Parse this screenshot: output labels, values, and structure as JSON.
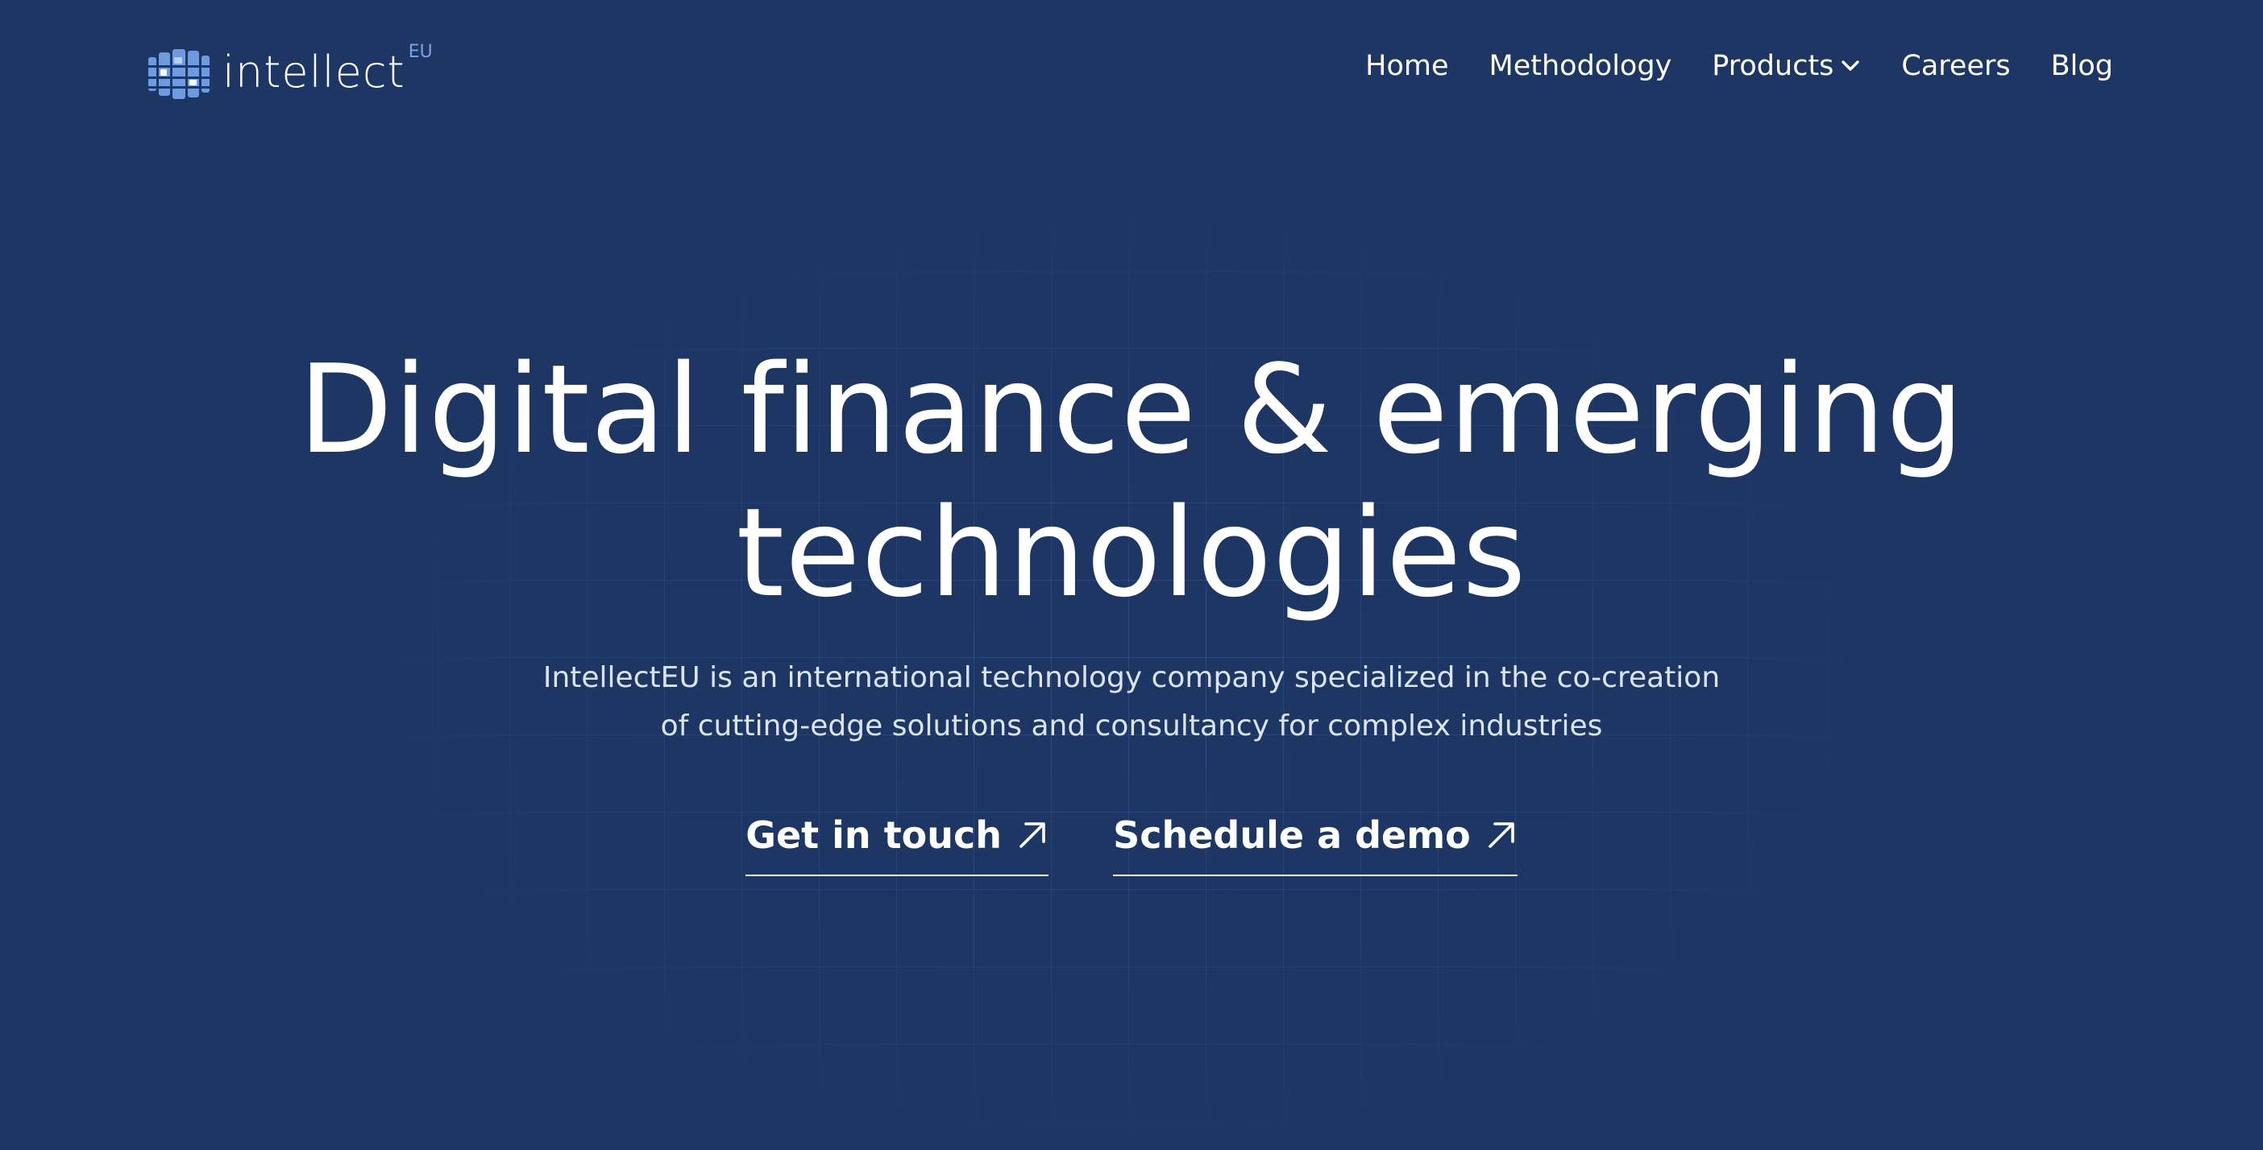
{
  "brand": {
    "name": "intellect",
    "superscript": "EU"
  },
  "nav": {
    "items": [
      {
        "label": "Home"
      },
      {
        "label": "Methodology"
      },
      {
        "label": "Products"
      },
      {
        "label": "Careers"
      },
      {
        "label": "Blog"
      }
    ]
  },
  "hero": {
    "title_line1": "Digital finance & emerging",
    "title_line2": "technologies",
    "subtitle_line1": "IntellectEU is an international technology company specialized in the co-creation",
    "subtitle_line2": "of cutting-edge solutions and consultancy for complex industries"
  },
  "cta": {
    "primary_label": "Get in touch",
    "secondary_label": "Schedule a demo"
  },
  "colors": {
    "background": "#1d3663",
    "accent": "#7aa3e6",
    "text": "#ffffff"
  },
  "icons": {
    "logo": "intellecteu-logo-mark",
    "products_dropdown": "chevron-down-icon",
    "cta_arrow": "arrow-up-right-icon"
  }
}
